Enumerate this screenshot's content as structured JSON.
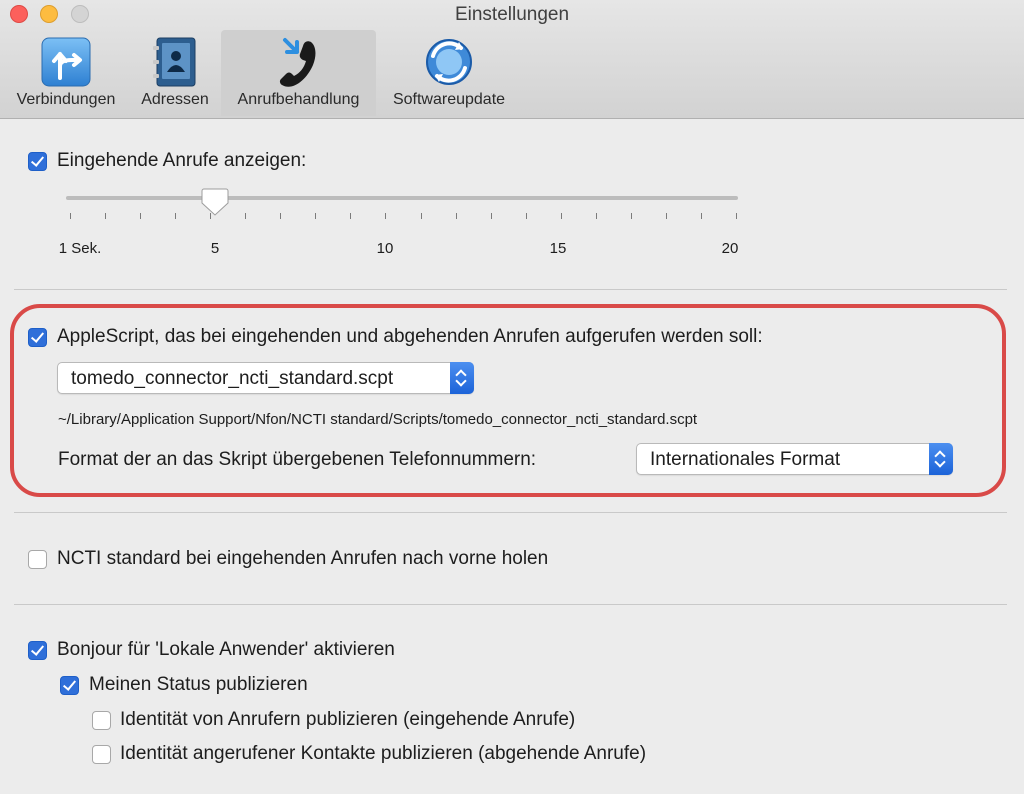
{
  "window": {
    "title": "Einstellungen"
  },
  "toolbar": {
    "items": [
      {
        "label": "Verbindungen",
        "icon": "connections-icon"
      },
      {
        "label": "Adressen",
        "icon": "address-book-icon"
      },
      {
        "label": "Anrufbehandlung",
        "icon": "phone-icon",
        "selected": true
      },
      {
        "label": "Softwareupdate",
        "icon": "software-update-icon"
      }
    ]
  },
  "incoming": {
    "label": "Eingehende Anrufe anzeigen:",
    "checked": true,
    "slider": {
      "min": 1,
      "max": 20,
      "value": 5,
      "ticks": 20,
      "tick_labels": [
        "1 Sek.",
        "5",
        "10",
        "15",
        "20"
      ]
    }
  },
  "applescript": {
    "label": "AppleScript, das bei eingehenden und abgehenden Anrufen aufgerufen werden soll:",
    "checked": true,
    "script_select": "tomedo_connector_ncti_standard.scpt",
    "path": "~/Library/Application Support/Nfon/NCTI standard/Scripts/tomedo_connector_ncti_standard.scpt",
    "format_label": "Format der an das Skript übergebenen Telefonnummern:",
    "format_select": "Internationales Format",
    "highlight_color": "#d94a48"
  },
  "front": {
    "label": "NCTI standard bei eingehenden Anrufen nach vorne holen",
    "checked": false
  },
  "bonjour": {
    "label": "Bonjour für 'Lokale Anwender' aktivieren",
    "checked": true,
    "status": {
      "label": "Meinen Status publizieren",
      "checked": true
    },
    "caller_identity": {
      "label": "Identität von Anrufern publizieren (eingehende Anrufe)",
      "checked": false
    },
    "callee_identity": {
      "label": "Identität angerufener Kontakte publizieren (abgehende Anrufe)",
      "checked": false
    }
  },
  "colors": {
    "accent": "#2f6fd9",
    "selected_tab": "#cfcfcf"
  }
}
